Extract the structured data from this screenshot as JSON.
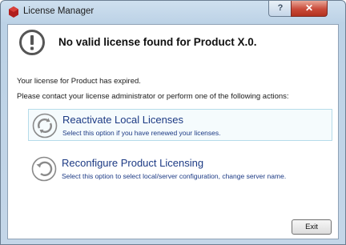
{
  "window": {
    "title": "License Manager",
    "help_label": "?",
    "close_label": "✕"
  },
  "header": {
    "icon": "exclamation-circle-icon",
    "title": "No valid license found for Product X.0."
  },
  "messages": {
    "expired": "Your license for Product has expired.",
    "instructions": "Please contact your license administrator or perform one of the following actions:"
  },
  "options": [
    {
      "icon": "reactivate-circular-arrows-icon",
      "title": "Reactivate Local Licenses",
      "description": "Select this option if you have renewed your licenses."
    },
    {
      "icon": "reconfigure-circular-arrow-icon",
      "title": "Reconfigure Product Licensing",
      "description": "Select this option to select local/server configuration, change server name."
    }
  ],
  "footer": {
    "exit_label": "Exit"
  },
  "colors": {
    "link_text": "#1c3a84",
    "close_button": "#c94a39",
    "hover_border": "#b6dcea"
  }
}
